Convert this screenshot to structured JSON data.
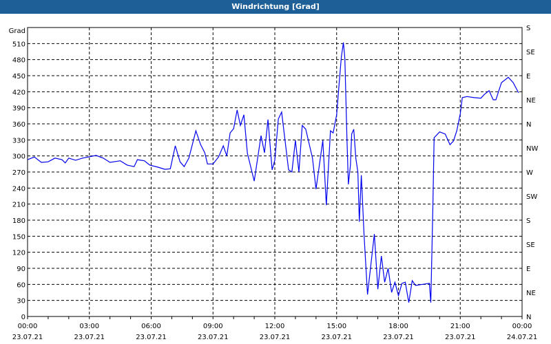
{
  "window": {
    "title": "Windrichtung [Grad]"
  },
  "chart_data": {
    "type": "line",
    "title": "Windrichtung [Grad]",
    "ylabel": "Grad",
    "ylim": [
      0,
      540
    ],
    "yticks": [
      0,
      30,
      60,
      90,
      120,
      150,
      180,
      210,
      240,
      270,
      300,
      330,
      360,
      390,
      420,
      450,
      480,
      510
    ],
    "y2ticks": [
      {
        "value": 0,
        "label": "N"
      },
      {
        "value": 45,
        "label": "NE"
      },
      {
        "value": 90,
        "label": "E"
      },
      {
        "value": 135,
        "label": "SE"
      },
      {
        "value": 180,
        "label": "S"
      },
      {
        "value": 225,
        "label": "SW"
      },
      {
        "value": 270,
        "label": "W"
      },
      {
        "value": 315,
        "label": "NW"
      },
      {
        "value": 360,
        "label": "N"
      },
      {
        "value": 405,
        "label": "NE"
      },
      {
        "value": 450,
        "label": "E"
      },
      {
        "value": 495,
        "label": "SE"
      },
      {
        "value": 540,
        "label": "S"
      }
    ],
    "xlim_hours": [
      0,
      24
    ],
    "xticks": [
      {
        "hour": 0,
        "time": "00:00",
        "date": "23.07.21"
      },
      {
        "hour": 3,
        "time": "03:00",
        "date": "23.07.21"
      },
      {
        "hour": 6,
        "time": "06:00",
        "date": "23.07.21"
      },
      {
        "hour": 9,
        "time": "09:00",
        "date": "23.07.21"
      },
      {
        "hour": 12,
        "time": "12:00",
        "date": "23.07.21"
      },
      {
        "hour": 15,
        "time": "15:00",
        "date": "23.07.21"
      },
      {
        "hour": 18,
        "time": "18:00",
        "date": "23.07.21"
      },
      {
        "hour": 21,
        "time": "21:00",
        "date": "23.07.21"
      },
      {
        "hour": 24,
        "time": "00:00",
        "date": "24.07.21"
      }
    ],
    "grid": true,
    "series": [
      {
        "name": "Windrichtung",
        "color": "#0000ee",
        "points": [
          [
            0,
            293
          ],
          [
            0.33,
            298
          ],
          [
            0.67,
            288
          ],
          [
            1,
            289
          ],
          [
            1.33,
            296
          ],
          [
            1.67,
            293
          ],
          [
            1.83,
            287
          ],
          [
            2,
            296
          ],
          [
            2.33,
            292
          ],
          [
            2.67,
            296
          ],
          [
            3.33,
            301
          ],
          [
            3.67,
            296
          ],
          [
            4,
            288
          ],
          [
            4.5,
            291
          ],
          [
            4.83,
            283
          ],
          [
            5.17,
            280
          ],
          [
            5.33,
            293
          ],
          [
            5.67,
            291
          ],
          [
            5.93,
            283
          ],
          [
            6.33,
            279
          ],
          [
            6.67,
            275
          ],
          [
            6.93,
            276
          ],
          [
            7.17,
            319
          ],
          [
            7.4,
            289
          ],
          [
            7.6,
            280
          ],
          [
            7.83,
            296
          ],
          [
            8.17,
            347
          ],
          [
            8.4,
            321
          ],
          [
            8.6,
            306
          ],
          [
            8.73,
            285
          ],
          [
            9,
            285
          ],
          [
            9.27,
            298
          ],
          [
            9.5,
            319
          ],
          [
            9.67,
            300
          ],
          [
            9.83,
            343
          ],
          [
            10,
            351
          ],
          [
            10.17,
            386
          ],
          [
            10.33,
            357
          ],
          [
            10.5,
            377
          ],
          [
            10.67,
            305
          ],
          [
            11,
            253
          ],
          [
            11.33,
            338
          ],
          [
            11.5,
            306
          ],
          [
            11.67,
            368
          ],
          [
            11.87,
            274
          ],
          [
            12,
            292
          ],
          [
            12.17,
            369
          ],
          [
            12.33,
            382
          ],
          [
            12.67,
            274
          ],
          [
            12.83,
            270
          ],
          [
            13,
            329
          ],
          [
            13.17,
            270
          ],
          [
            13.33,
            357
          ],
          [
            13.5,
            350
          ],
          [
            13.83,
            296
          ],
          [
            14,
            238
          ],
          [
            14.33,
            329
          ],
          [
            14.5,
            208
          ],
          [
            14.7,
            347
          ],
          [
            14.83,
            343
          ],
          [
            15,
            377
          ],
          [
            15.1,
            424
          ],
          [
            15.23,
            485
          ],
          [
            15.33,
            512
          ],
          [
            15.4,
            482
          ],
          [
            15.5,
            334
          ],
          [
            15.57,
            247
          ],
          [
            15.67,
            283
          ],
          [
            15.73,
            341
          ],
          [
            15.83,
            350
          ],
          [
            15.93,
            296
          ],
          [
            16.03,
            270
          ],
          [
            16.1,
            177
          ],
          [
            16.2,
            264
          ],
          [
            16.27,
            206
          ],
          [
            16.33,
            154
          ],
          [
            16.5,
            41
          ],
          [
            16.83,
            154
          ],
          [
            17,
            51
          ],
          [
            17.17,
            113
          ],
          [
            17.33,
            64
          ],
          [
            17.5,
            90
          ],
          [
            17.67,
            45
          ],
          [
            17.83,
            64
          ],
          [
            18,
            39
          ],
          [
            18.17,
            62
          ],
          [
            18.33,
            64
          ],
          [
            18.5,
            26
          ],
          [
            18.67,
            67
          ],
          [
            18.83,
            58
          ],
          [
            19.17,
            60
          ],
          [
            19.5,
            62
          ],
          [
            19.57,
            26
          ],
          [
            19.67,
            206
          ],
          [
            19.73,
            334
          ],
          [
            20,
            345
          ],
          [
            20.27,
            341
          ],
          [
            20.5,
            321
          ],
          [
            20.67,
            328
          ],
          [
            20.83,
            347
          ],
          [
            21,
            379
          ],
          [
            21.1,
            409
          ],
          [
            21.33,
            411
          ],
          [
            21.67,
            409
          ],
          [
            22,
            408
          ],
          [
            22.17,
            415
          ],
          [
            22.4,
            422
          ],
          [
            22.6,
            405
          ],
          [
            22.73,
            405
          ],
          [
            23,
            437
          ],
          [
            23.33,
            447
          ],
          [
            23.57,
            437
          ],
          [
            23.83,
            418
          ]
        ]
      }
    ]
  }
}
